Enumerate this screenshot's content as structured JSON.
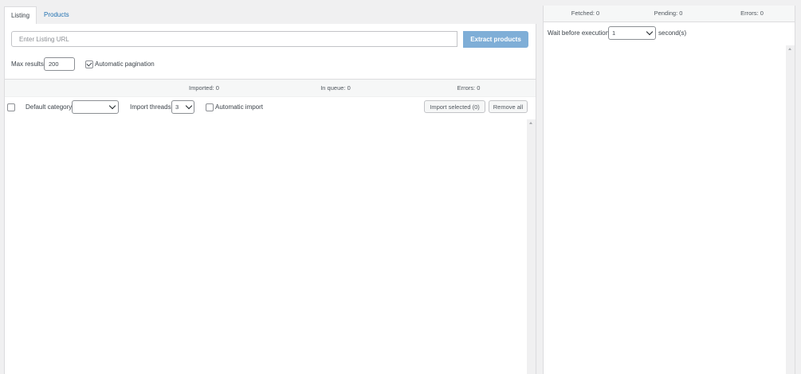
{
  "tabs": [
    {
      "label": "Listing",
      "active": true
    },
    {
      "label": "Products",
      "active": false
    }
  ],
  "listing": {
    "url_placeholder": "Enter Listing URL",
    "url_value": "",
    "extract_label": "Extract products",
    "max_results_label": "Max results",
    "max_results_value": "200",
    "auto_pagination_label": "Automatic pagination",
    "auto_pagination_checked": true
  },
  "stats": {
    "imported": "Imported: 0",
    "in_queue": "In queue: 0",
    "errors": "Errors: 0"
  },
  "toolbar": {
    "default_category_label": "Default category",
    "default_category_value": "",
    "import_threads_label": "Import threads",
    "import_threads_value": "3",
    "auto_import_label": "Automatic import",
    "auto_import_checked": false,
    "import_selected_label": "Import selected (0)",
    "remove_all_label": "Remove all"
  },
  "right_panel": {
    "fetched": "Fetched: 0",
    "pending": "Pending: 0",
    "errors": "Errors: 0",
    "wait_label": "Wait before execution",
    "wait_value": "1",
    "wait_unit": "second(s)"
  },
  "colors": {
    "accent": "#2271b1",
    "extract_button": "#7faed7",
    "background": "#f0f0f1"
  },
  "icons": [
    "chevron-down-icon",
    "checkmark-icon",
    "scroll-up-arrow-icon"
  ]
}
